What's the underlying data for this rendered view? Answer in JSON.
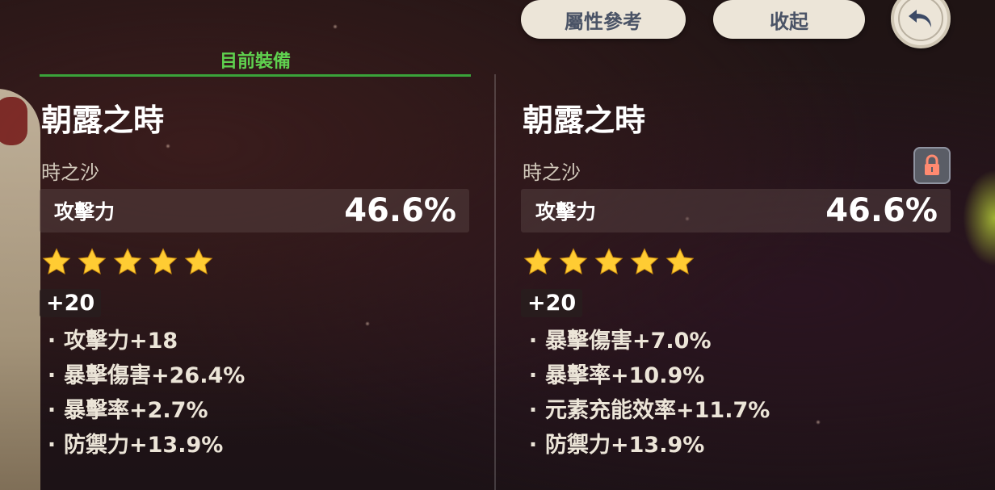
{
  "header": {
    "attribute_reference_label": "屬性參考",
    "collapse_label": "收起",
    "back_icon": "undo-arrow-icon"
  },
  "equipped_tab": {
    "label": "目前裝備",
    "color": "#5fd14f"
  },
  "left_artifact": {
    "name": "朝露之時",
    "slot_type": "時之沙",
    "main_stat_label": "攻擊力",
    "main_stat_value": "46.6%",
    "stars": 5,
    "level": "+20",
    "substats": [
      "攻擊力+18",
      "暴擊傷害+26.4%",
      "暴擊率+2.7%",
      "防禦力+13.9%"
    ]
  },
  "right_artifact": {
    "name": "朝露之時",
    "slot_type": "時之沙",
    "main_stat_label": "攻擊力",
    "main_stat_value": "46.6%",
    "stars": 5,
    "level": "+20",
    "locked": true,
    "lock_icon": "lock-icon",
    "substats": [
      "暴擊傷害+7.0%",
      "暴擊率+10.9%",
      "元素充能效率+11.7%",
      "防禦力+13.9%"
    ]
  },
  "colors": {
    "star": "#ffcc33",
    "button_bg": "#ece5d8",
    "button_text": "#4a5366",
    "lock_bg": "#5a5d66",
    "lock_icon": "#ff8a70"
  }
}
